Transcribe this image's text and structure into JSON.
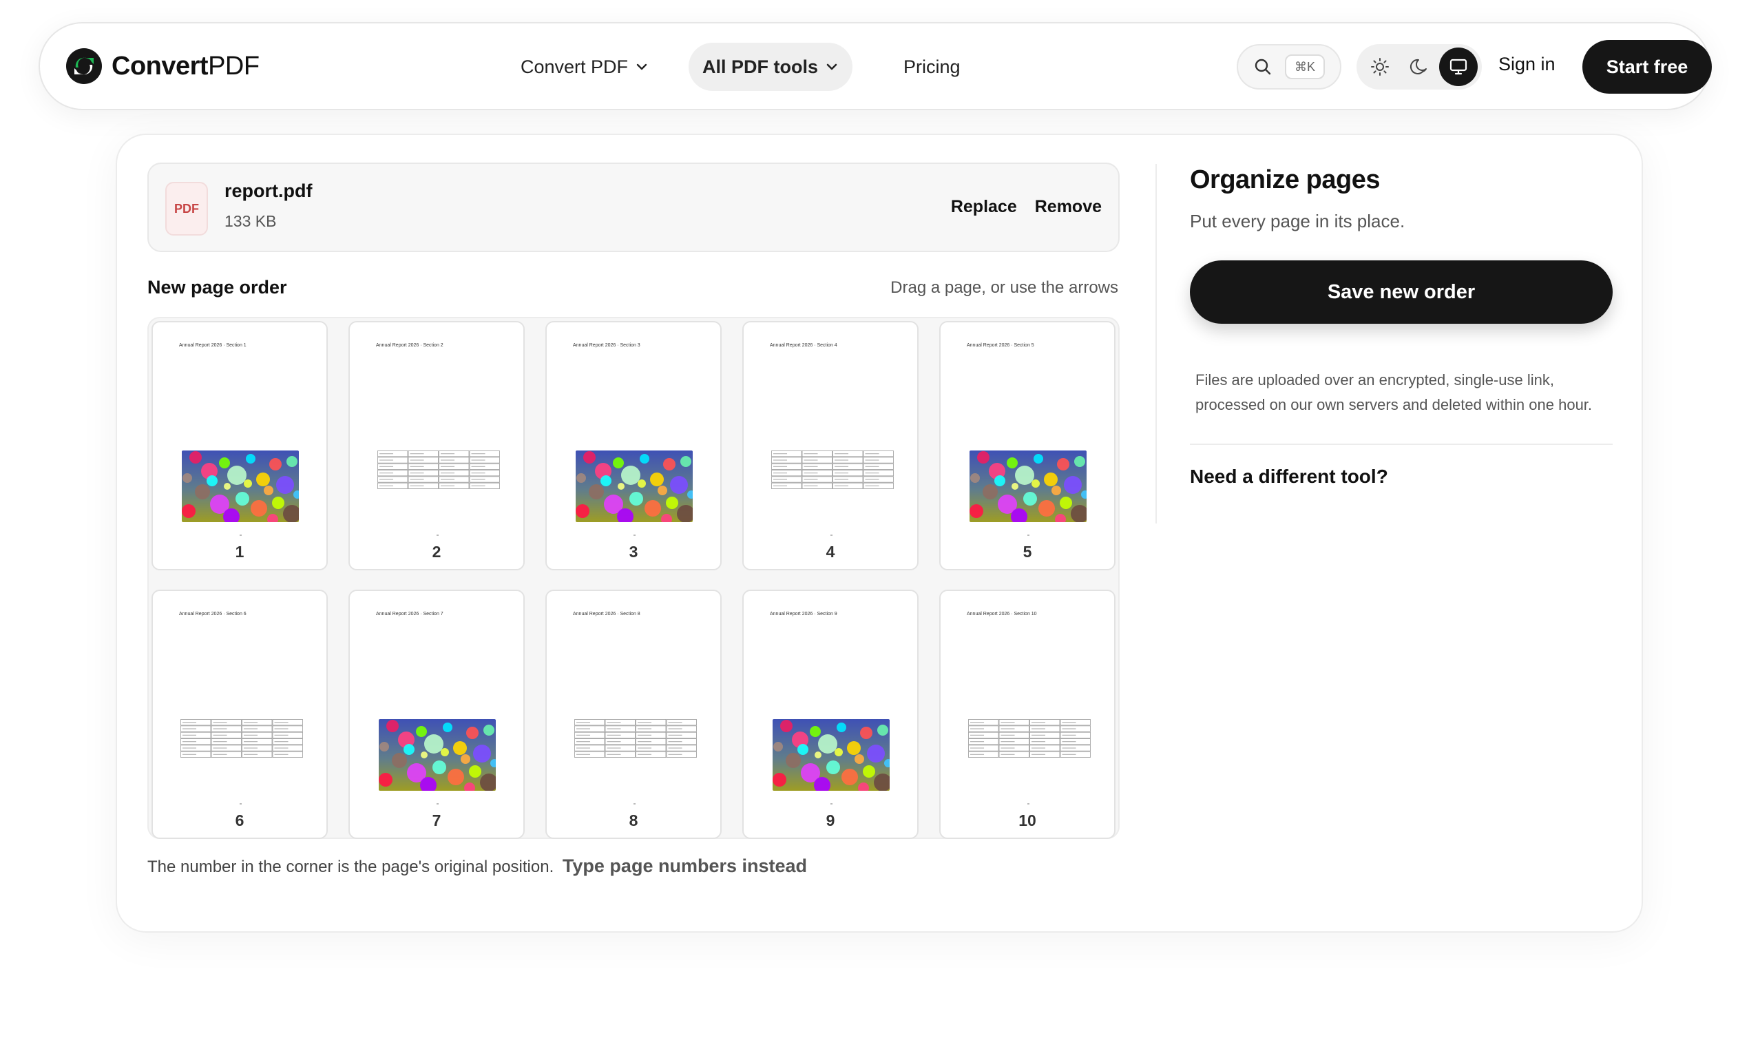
{
  "brand": {
    "name_bold": "Convert",
    "name_regular": "PDF"
  },
  "nav": {
    "items": [
      {
        "label": "Convert PDF",
        "has_chevron": true,
        "active": false
      },
      {
        "label": "All PDF tools",
        "has_chevron": true,
        "active": true
      },
      {
        "label": "Pricing",
        "has_chevron": false,
        "active": false
      }
    ],
    "search_shortcut": "⌘K",
    "theme_options": [
      "sun-icon",
      "moon-icon",
      "monitor-icon"
    ],
    "theme_selected": "monitor-icon",
    "sign_in": "Sign in",
    "cta": "Start free"
  },
  "file": {
    "badge": "PDF",
    "name": "report.pdf",
    "size": "133 KB",
    "replace": "Replace",
    "remove": "Remove"
  },
  "order": {
    "title": "New page order",
    "hint": "Drag a page, or use the arrows",
    "pages": [
      {
        "number": "1",
        "header": "Annual Report 2026 · Section 1",
        "content": "image"
      },
      {
        "number": "2",
        "header": "Annual Report 2026 · Section 2",
        "content": "table"
      },
      {
        "number": "3",
        "header": "Annual Report 2026 · Section 3",
        "content": "image"
      },
      {
        "number": "4",
        "header": "Annual Report 2026 · Section 4",
        "content": "table"
      },
      {
        "number": "5",
        "header": "Annual Report 2026 · Section 5",
        "content": "image"
      },
      {
        "number": "6",
        "header": "Annual Report 2026 · Section 6",
        "content": "table"
      },
      {
        "number": "7",
        "header": "Annual Report 2026 · Section 7",
        "content": "image"
      },
      {
        "number": "8",
        "header": "Annual Report 2026 · Section 8",
        "content": "table"
      },
      {
        "number": "9",
        "header": "Annual Report 2026 · Section 9",
        "content": "image"
      },
      {
        "number": "10",
        "header": "Annual Report 2026 · Section 10",
        "content": "table"
      }
    ],
    "note": "The number in the corner is the page's original position.",
    "note_link": "Type page numbers instead"
  },
  "sidebar": {
    "title": "Organize pages",
    "subtitle": "Put every page in its place.",
    "save": "Save new order",
    "privacy": "Files are uploaded over an encrypted, single-use link, processed on our own servers and deleted within one hour.",
    "need_tool": "Need a different tool?"
  },
  "colors": {
    "primary_dark": "#161616",
    "logo_green": "#1db954",
    "pdf_badge_red": "#c74444",
    "surface_gray": "#f6f6f6"
  }
}
